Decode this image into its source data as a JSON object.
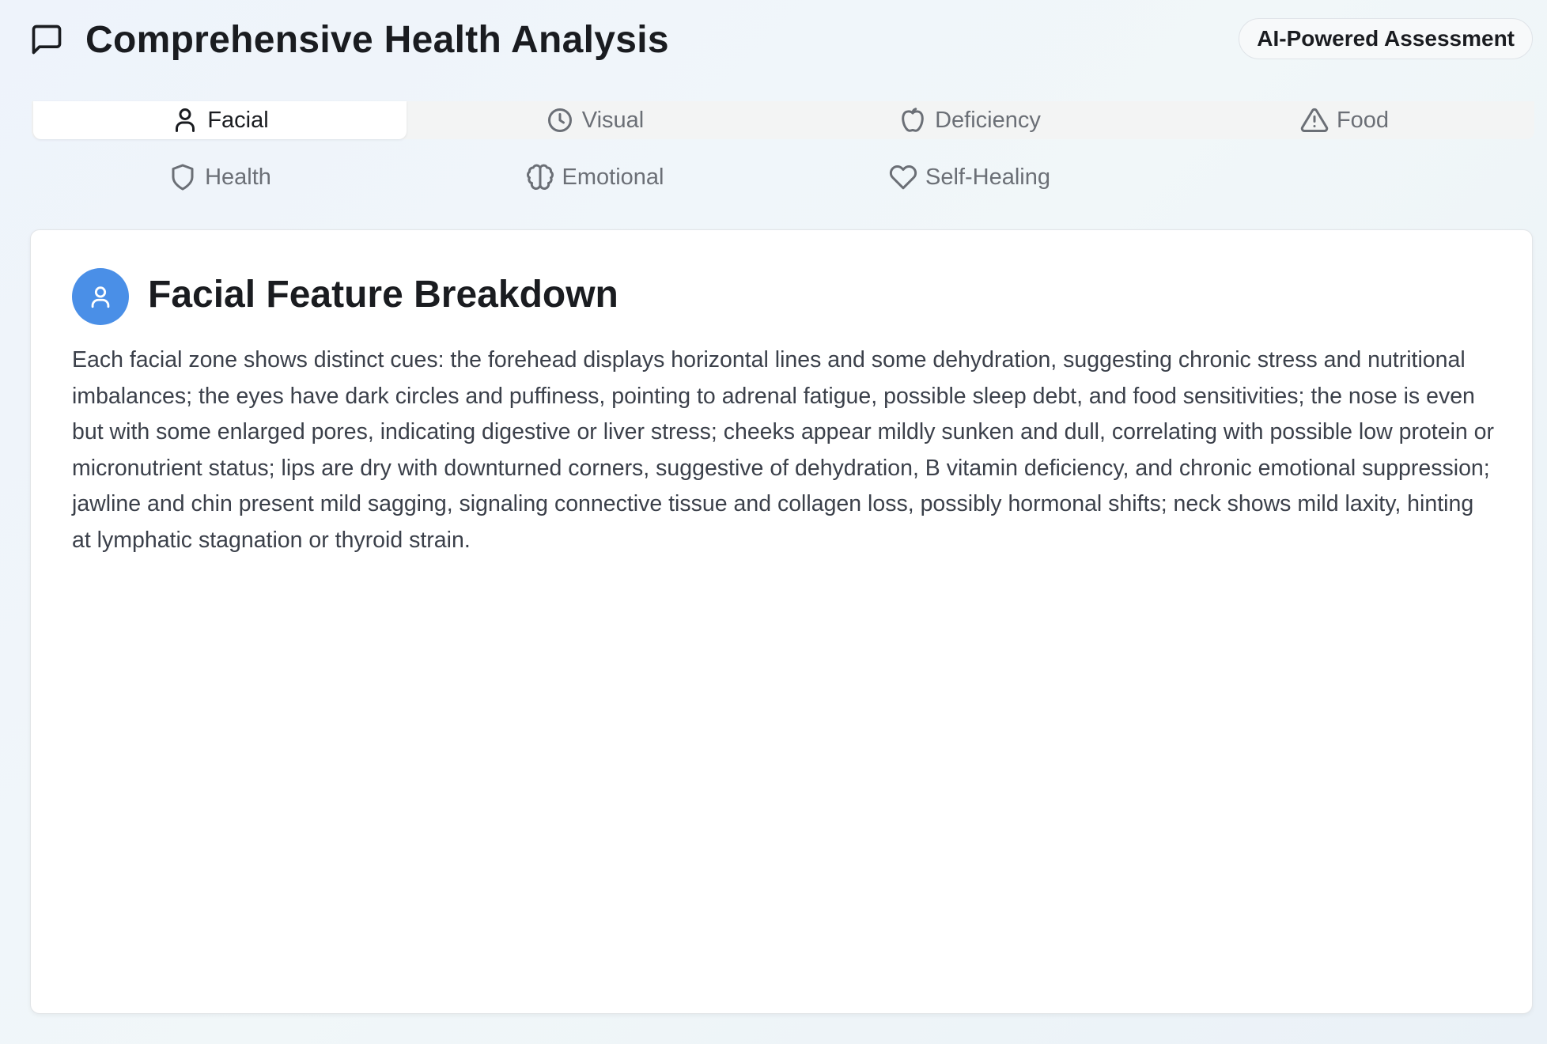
{
  "header": {
    "title": "Comprehensive Health Analysis",
    "icon": "chat-bubble-icon",
    "badge": "AI-Powered Assessment"
  },
  "tabs": [
    {
      "label": "Facial",
      "icon": "user-icon",
      "active": true
    },
    {
      "label": "Visual",
      "icon": "clock-icon",
      "active": false
    },
    {
      "label": "Deficiency",
      "icon": "apple-icon",
      "active": false
    },
    {
      "label": "Food",
      "icon": "warning-triangle-icon",
      "active": false
    },
    {
      "label": "Health",
      "icon": "shield-icon",
      "active": false
    },
    {
      "label": "Emotional",
      "icon": "brain-icon",
      "active": false
    },
    {
      "label": "Self-Healing",
      "icon": "heart-icon",
      "active": false
    }
  ],
  "section": {
    "title": "Facial Feature Breakdown",
    "icon": "user-icon",
    "body": "Each facial zone shows distinct cues: the forehead displays horizontal lines and some dehydration, suggesting chronic stress and nutritional imbalances; the eyes have dark circles and puffiness, pointing to adrenal fatigue, possible sleep debt, and food sensitivities; the nose is even but with some enlarged pores, indicating digestive or liver stress; cheeks appear mildly sunken and dull, correlating with possible low protein or micronutrient status; lips are dry with downturned corners, suggestive of dehydration, B vitamin deficiency, and chronic emotional suppression; jawline and chin present mild sagging, signaling connective tissue and collagen loss, possibly hormonal shifts; neck shows mild laxity, hinting at lymphatic stagnation or thyroid strain."
  },
  "colors": {
    "accent": "#4a8fe7",
    "text_primary": "#1a1c20",
    "text_muted": "#6b6f76",
    "body_text": "#3b404a"
  }
}
